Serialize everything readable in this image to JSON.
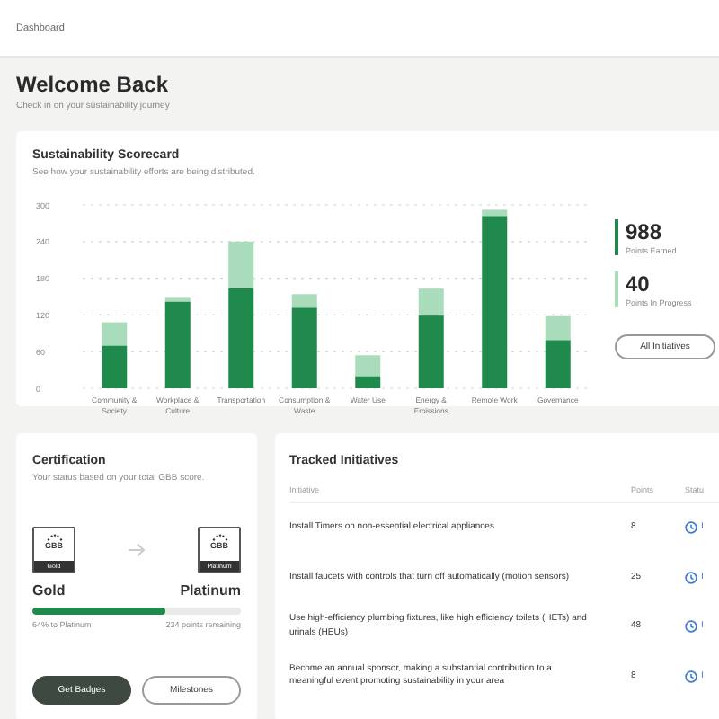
{
  "breadcrumb": "Dashboard",
  "header": {
    "title": "Welcome Back",
    "subtitle": "Check in on your sustainability journey"
  },
  "scorecard": {
    "title": "Sustainability Scorecard",
    "subtitle": "See how your sustainability efforts are being distributed.",
    "chart_data": {
      "type": "bar",
      "stacked": true,
      "grid": true,
      "categories": [
        "Community & Society",
        "Workplace & Culture",
        "Transportation",
        "Consumption & Waste",
        "Water Use",
        "Energy & Emissions",
        "Remote Work",
        "Governance"
      ],
      "ylim": [
        0,
        300
      ],
      "yticks": [
        0,
        60,
        120,
        180,
        240,
        300
      ],
      "series": [
        {
          "name": "Points Earned",
          "color": "#1f8a4c",
          "values": [
            70,
            142,
            164,
            132,
            20,
            119,
            282,
            79
          ]
        },
        {
          "name": "Points In Progress",
          "color": "#a9dcba",
          "values": [
            38,
            6,
            76,
            22,
            34,
            44,
            10,
            39
          ]
        }
      ]
    },
    "stats": [
      {
        "value": "988"
      },
      {
        "value": "40"
      }
    ],
    "button": "All Initiatives"
  },
  "certification": {
    "title": "Certification",
    "subtitle": "Your status based on your total GBB score.",
    "current": {
      "badge": "GBB",
      "badge_label": "Gold",
      "tier": "Gold"
    },
    "next": {
      "badge": "GBB",
      "badge_label": "Platinum",
      "tier": "Platinum"
    },
    "level": 0.64,
    "progress_text": "64% to Platinum",
    "remaining": "234 points remaining",
    "buttons": [
      {
        "label": "Get Badges",
        "primary": true
      },
      {
        "label": "Milestones",
        "primary": false
      }
    ]
  },
  "initiatives": {
    "title": "Tracked Initiatives",
    "columns": [
      "Initiative",
      "Points",
      "Statu"
    ],
    "rows": [
      {
        "initiative": "Install Timers on non-essential electrical appliances",
        "points": "8",
        "status": "I"
      },
      {
        "initiative": "Install faucets with controls that turn off automatically (motion sensors)",
        "points": "25",
        "status": "I"
      },
      {
        "initiative": "Use high-efficiency plumbing fixtures, like high efficiency toilets (HETs) and urinals (HEUs)",
        "points": "48",
        "status": "I"
      },
      {
        "initiative": "Become an annual sponsor, making a substantial contribution to a meaningful event promoting sustainability in your area",
        "points": "8",
        "status": "I"
      }
    ]
  }
}
